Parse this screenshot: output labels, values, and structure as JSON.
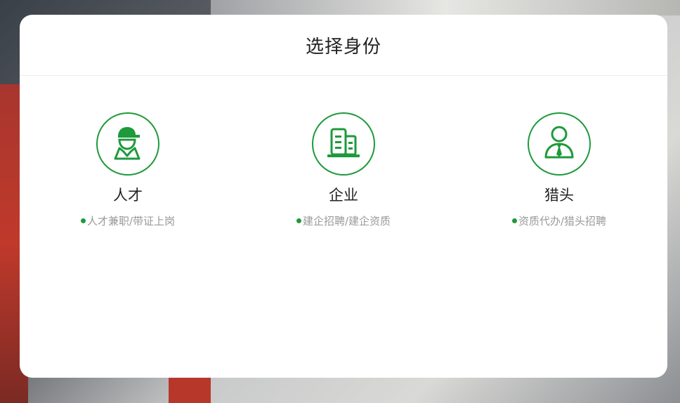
{
  "modal": {
    "title": "选择身份"
  },
  "options": [
    {
      "label": "人才",
      "desc": "人才兼职/带证上岗",
      "icon": "worker-icon"
    },
    {
      "label": "企业",
      "desc": "建企招聘/建企资质",
      "icon": "building-icon"
    },
    {
      "label": "猎头",
      "desc": "资质代办/猎头招聘",
      "icon": "headhunter-icon"
    }
  ],
  "colors": {
    "accent": "#1e9a3c",
    "title": "#222222",
    "desc": "#999999"
  }
}
